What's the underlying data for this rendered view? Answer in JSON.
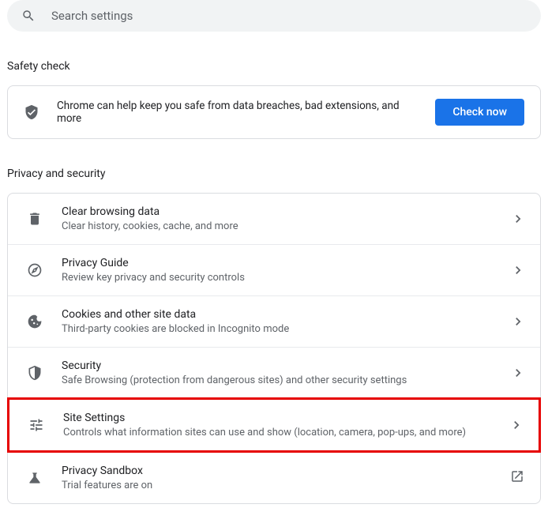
{
  "search": {
    "placeholder": "Search settings"
  },
  "safety": {
    "heading": "Safety check",
    "message": "Chrome can help keep you safe from data breaches, bad extensions, and more",
    "button": "Check now"
  },
  "privacy": {
    "heading": "Privacy and security",
    "items": [
      {
        "title": "Clear browsing data",
        "subtitle": "Clear history, cookies, cache, and more",
        "icon": "trash",
        "action": "arrow"
      },
      {
        "title": "Privacy Guide",
        "subtitle": "Review key privacy and security controls",
        "icon": "compass",
        "action": "arrow"
      },
      {
        "title": "Cookies and other site data",
        "subtitle": "Third-party cookies are blocked in Incognito mode",
        "icon": "cookie",
        "action": "arrow"
      },
      {
        "title": "Security",
        "subtitle": "Safe Browsing (protection from dangerous sites) and other security settings",
        "icon": "shield",
        "action": "arrow"
      },
      {
        "title": "Site Settings",
        "subtitle": "Controls what information sites can use and show (location, camera, pop-ups, and more)",
        "icon": "sliders",
        "action": "arrow",
        "highlighted": true
      },
      {
        "title": "Privacy Sandbox",
        "subtitle": "Trial features are on",
        "icon": "flask",
        "action": "external"
      }
    ]
  }
}
